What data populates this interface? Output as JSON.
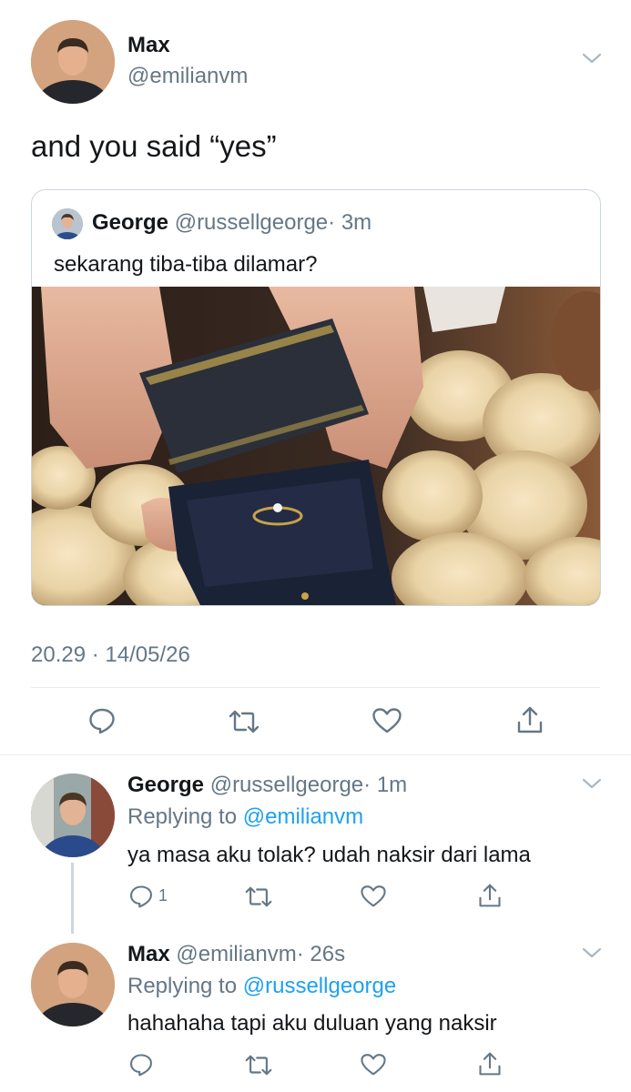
{
  "main_tweet": {
    "author_name": "Max",
    "author_handle": "@emilianvm",
    "text": "and you said “yes”",
    "timestamp": "20.29 · 14/05/26",
    "quoted": {
      "author_name": "George",
      "author_handle": "@russellgeorge",
      "time": "· 3m",
      "text": "sekarang tiba-tiba dilamar?"
    }
  },
  "replies": [
    {
      "author_name": "George",
      "author_handle": "@russellgeorge",
      "time": "· 1m",
      "replying_label": "Replying to",
      "replying_to": "@emilianvm",
      "text": "ya masa aku tolak? udah naksir dari lama",
      "reply_count": "1"
    },
    {
      "author_name": "Max",
      "author_handle": "@emilianvm",
      "time": "· 26s",
      "replying_label": "Replying to",
      "replying_to": "@russellgeorge",
      "text": "hahahaha tapi aku duluan yang naksir"
    }
  ],
  "icons": [
    "chevron-down-icon",
    "reply-icon",
    "retweet-icon",
    "like-icon",
    "share-icon"
  ],
  "colors": {
    "link": "#1da1f2",
    "muted": "#657786",
    "divider": "#e6ecf0"
  }
}
